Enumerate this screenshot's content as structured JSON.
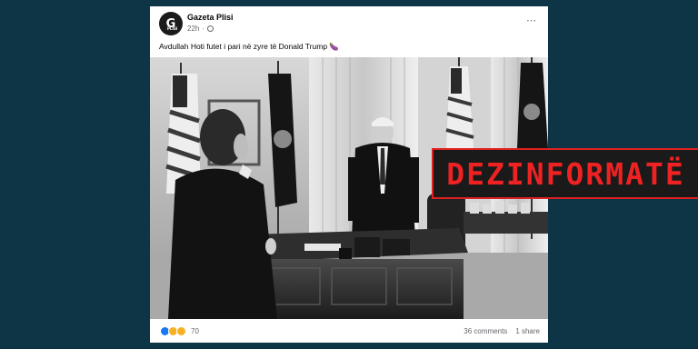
{
  "post": {
    "page_name": "Gazeta Plisi",
    "avatar_letter": "G",
    "avatar_sub": "PLISI",
    "timestamp": "22h",
    "more_icon": "⋯",
    "caption": "Avdullah Hoti futet i pari në zyre të Donald Trump 🍆",
    "photo_alt": "Black and white photo in the Oval Office",
    "reaction_count": "70",
    "comments": "36 comments",
    "shares": "1 share"
  },
  "stamp": {
    "label": "DEZINFORMATË",
    "color": "#ee2222"
  },
  "colors": {
    "background": "#0d3545",
    "card": "#ffffff"
  }
}
